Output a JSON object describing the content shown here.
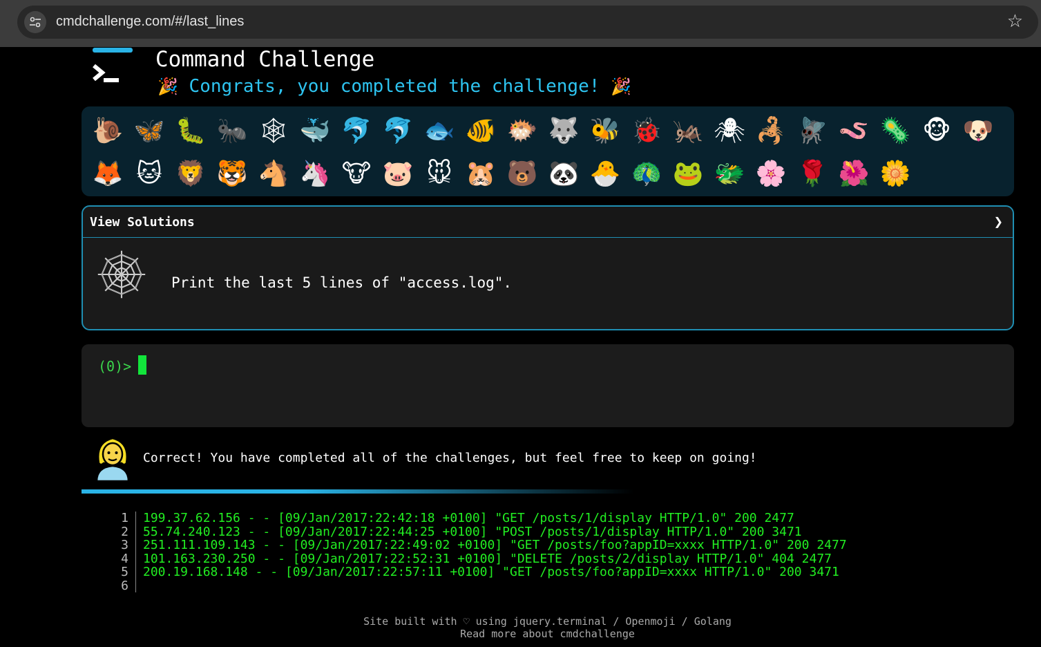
{
  "browser": {
    "url": "cmdchallenge.com/#/last_lines",
    "site_info_icon": "tune-icon",
    "bookmark_icon": "star-outline-icon"
  },
  "header": {
    "title": "Command Challenge",
    "congrats": "Congrats, you completed the challenge!",
    "party_emoji": "🎉"
  },
  "emojis": [
    "🐌",
    "🦋",
    "🐛",
    "🐜",
    "🕸",
    "🐳",
    "🐬",
    "🐬",
    "🐟",
    "🐠",
    "🐡",
    "🐺",
    "🐝",
    "🐞",
    "🦗",
    "🕷",
    "🦂",
    "🪰",
    "🪱",
    "🦠",
    "🐵",
    "🐶",
    "🦊",
    "🐱",
    "🦁",
    "🐯",
    "🐴",
    "🦄",
    "🐮",
    "🐷",
    "🐭",
    "🐹",
    "🐻",
    "🐼",
    "🐣",
    "🦚",
    "🐸",
    "🐲",
    "🌸",
    "🌹",
    "🌺",
    "🌼"
  ],
  "solutions": {
    "label": "View Solutions",
    "chevron": "❯"
  },
  "challenge": {
    "icon": "spider-web-icon",
    "text": "Print the last 5 lines of \"access.log\"."
  },
  "terminal": {
    "prompt": "(0)>"
  },
  "feedback": {
    "text": "Correct! You have completed all of the challenges, but feel free to keep on going!"
  },
  "output": [
    {
      "n": "1",
      "text": "199.37.62.156 - - [09/Jan/2017:22:42:18 +0100] \"GET /posts/1/display HTTP/1.0\" 200 2477"
    },
    {
      "n": "2",
      "text": "55.74.240.123 - - [09/Jan/2017:22:44:25 +0100] \"POST /posts/1/display HTTP/1.0\" 200 3471"
    },
    {
      "n": "3",
      "text": "251.111.109.143 - - [09/Jan/2017:22:49:02 +0100] \"GET /posts/foo?appID=xxxx HTTP/1.0\" 200 2477"
    },
    {
      "n": "4",
      "text": "101.163.230.250 - - [09/Jan/2017:22:52:31 +0100] \"DELETE /posts/2/display HTTP/1.0\" 404 2477"
    },
    {
      "n": "5",
      "text": "200.19.168.148 - - [09/Jan/2017:22:57:11 +0100] \"GET /posts/foo?appID=xxxx HTTP/1.0\" 200 3471"
    },
    {
      "n": "6",
      "text": ""
    }
  ],
  "footer": {
    "line1_prefix": "Site built with ♡ using ",
    "link_jquery": "jquery.terminal",
    "sep1": " / ",
    "link_openmoji": "Openmoji",
    "sep2": " / ",
    "link_golang": "Golang",
    "link_readmore": "Read more about cmdchallenge"
  }
}
